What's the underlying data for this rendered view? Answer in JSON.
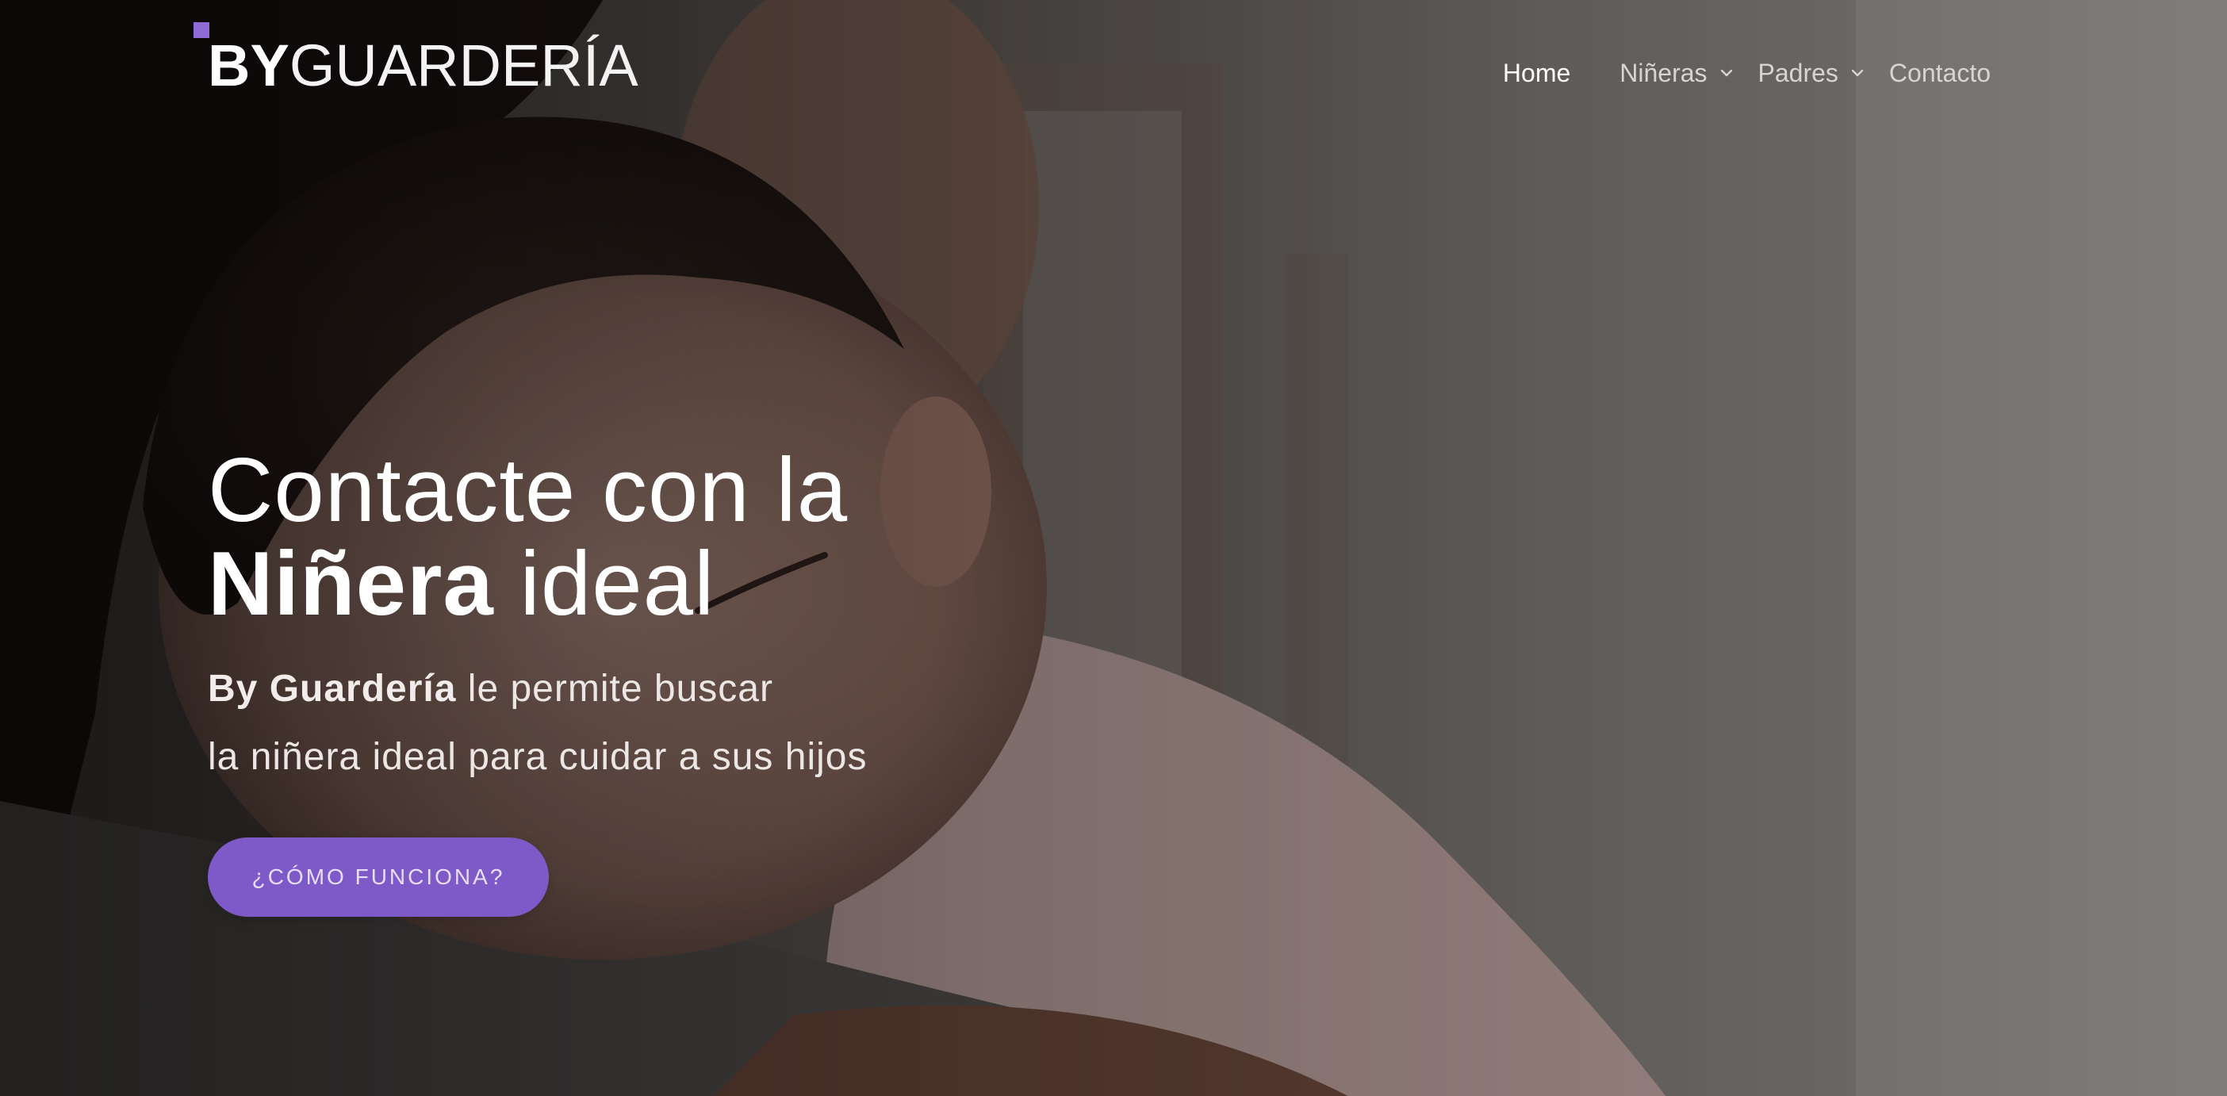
{
  "brand": {
    "name_bold": "BY",
    "name_light": "GUARDERÍA",
    "accent_color": "#8e6ad6"
  },
  "nav": {
    "items": [
      {
        "label": "Home",
        "active": true
      },
      {
        "label": "Niñeras",
        "has_dropdown": true,
        "icon": "chevron-down-icon"
      },
      {
        "label": "Padres",
        "has_dropdown": true,
        "icon": "chevron-down-icon"
      },
      {
        "label": "Contacto"
      }
    ]
  },
  "hero": {
    "headline_line1": "Contacte con la",
    "headline_bold": "Niñera",
    "headline_rest": " ideal",
    "subtitle_bold": "By Guardería",
    "subtitle_line1_rest": " le permite buscar",
    "subtitle_line2": "la niñera ideal para cuidar a sus hijos",
    "cta_label": "¿CÓMO FUNCIONA?",
    "cta_color": "#7e5ac8",
    "background_image": "baby-sleeping-on-shoulder-photo"
  }
}
